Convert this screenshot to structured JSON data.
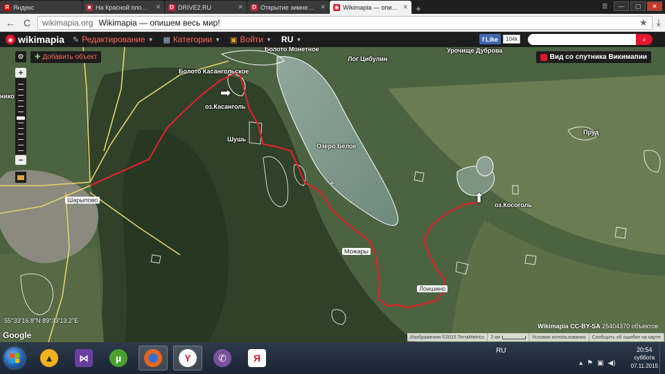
{
  "browser": {
    "tabs": [
      {
        "label": "Яндекс",
        "favicon_color": "#cc0000",
        "favicon_glyph": "Я",
        "active": false
      },
      {
        "label": "На Красной площади тыс",
        "favicon_color": "#aa3333",
        "favicon_glyph": "■",
        "active": false
      },
      {
        "label": "DRIVE2.RU",
        "favicon_color": "#c0243c",
        "favicon_glyph": "D",
        "active": false
      },
      {
        "label": "Открытие зимней рыбал",
        "favicon_color": "#c0243c",
        "favicon_glyph": "D",
        "active": false
      },
      {
        "label": "Wikimapia — опишем вес",
        "favicon_color": "#e5162b",
        "favicon_glyph": "◉",
        "active": true
      }
    ],
    "address": {
      "host": "wikimapia.org",
      "title": "Wikimapia — опишем весь мир!"
    }
  },
  "wikimapia": {
    "logo_text": "wikimapia",
    "menu": [
      {
        "label": "Редактирование",
        "icon": "edit-icon"
      },
      {
        "label": "Категории",
        "icon": "categories-icon"
      },
      {
        "label": "Войти",
        "icon": "login-icon"
      }
    ],
    "language": "RU",
    "fb_like_label": "Like",
    "fb_like_count": "104k",
    "search_placeholder": "",
    "add_object_label": "Добавить объект",
    "satellite_view_label": "Вид со спутника Викимапии"
  },
  "map": {
    "labels": [
      {
        "name": "label-boloto-monetnoe",
        "text": "Болото Монетное",
        "kind": "text"
      },
      {
        "name": "label-log-tsibulin",
        "text": "Лог Цибулин",
        "kind": "text"
      },
      {
        "name": "label-urochishche-dubrova",
        "text": "Урочище Дуброва",
        "kind": "text"
      },
      {
        "name": "label-boloto-kasangolskoe",
        "text": "Болото Касангольское",
        "kind": "text"
      },
      {
        "name": "label-oz-kasangol",
        "text": "оз.Касанголь",
        "kind": "text"
      },
      {
        "name": "label-shush",
        "text": "Шушь",
        "kind": "text"
      },
      {
        "name": "label-ozero-beloe",
        "text": "Озеро Белое",
        "kind": "text"
      },
      {
        "name": "label-prud",
        "text": "Пруд",
        "kind": "text"
      },
      {
        "name": "label-oz-kosogol",
        "text": "оз.Косоголь",
        "kind": "text"
      },
      {
        "name": "label-sharypovo",
        "text": "Шарыпово",
        "kind": "place"
      },
      {
        "name": "label-mozhary",
        "text": "Можары",
        "kind": "place"
      },
      {
        "name": "label-loishino",
        "text": "Лоишино",
        "kind": "place"
      },
      {
        "name": "label-nikino",
        "text": "нико",
        "kind": "text"
      }
    ],
    "coordinates": "55°33'16.8\"N 89°33'13.2\"E",
    "google_logo": "Google",
    "license_prefix": "Wikimapia CC-BY-SA",
    "objects_count": "25404370 объектов",
    "attribution": {
      "imagery": "Изображения ©2015 TerraMetrics",
      "scale": "2 км",
      "terms": "Условия использования",
      "report": "Сообщить об ошибке на карте"
    },
    "colors": {
      "route": "#e0222a",
      "roads": "#e6d36a",
      "outlines": "#ffffff"
    }
  },
  "taskbar": {
    "apps": [
      {
        "name": "aimp",
        "icon": "aimp-icon",
        "color": "#f2b01e",
        "glyph": "▲"
      },
      {
        "name": "visual-studio",
        "icon": "visual-studio-icon",
        "color": "#6a3fa0",
        "glyph": "⋈"
      },
      {
        "name": "utorrent",
        "icon": "utorrent-icon",
        "color": "#4aa02c",
        "glyph": "µ"
      },
      {
        "name": "firefox",
        "icon": "firefox-icon",
        "color": "#e8661c",
        "glyph": "◉"
      },
      {
        "name": "yandex-browser",
        "icon": "yandex-browser-icon",
        "color": "#e5162b",
        "glyph": "Y"
      },
      {
        "name": "viber",
        "icon": "viber-icon",
        "color": "#7b519d",
        "glyph": "✆"
      },
      {
        "name": "yandex",
        "icon": "yandex-icon",
        "color": "#e5162b",
        "glyph": "Я"
      }
    ],
    "language": "RU",
    "time": "20:54",
    "day": "суббота",
    "date": "07.11.2015"
  }
}
